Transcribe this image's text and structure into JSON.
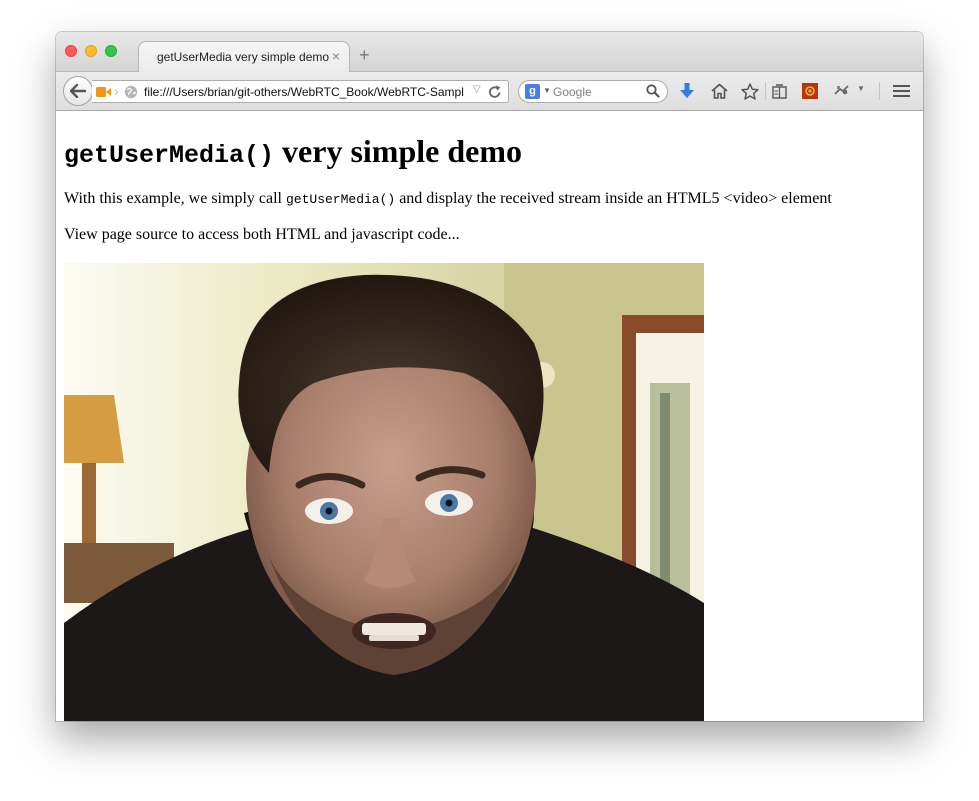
{
  "browser": {
    "tab_title": "getUserMedia very simple demo",
    "tab_close": "×",
    "new_tab": "+",
    "url": "file:///Users/brian/git-others/WebRTC_Book/WebRTC-Sampl",
    "search_placeholder": "Google",
    "search_engine_letter": "g"
  },
  "page": {
    "title_code": "getUserMedia()",
    "title_rest": " very simple demo",
    "intro_before": "With this example, we simply call ",
    "intro_code": "getUserMedia()",
    "intro_after": " and display the received stream inside an HTML5 <video> element",
    "source_note": "View page source to access both HTML and javascript code..."
  },
  "icons": [
    "back-arrow-icon",
    "camera-icon",
    "globe-icon",
    "reload-icon",
    "search-icon",
    "download-icon",
    "home-icon",
    "star-icon",
    "reading-list-icon",
    "addon-icon",
    "developer-icon",
    "menu-icon"
  ],
  "colors": {
    "download_arrow": "#2f7fe0",
    "camera_orange": "#f29716",
    "addon_red": "#b5360f"
  }
}
